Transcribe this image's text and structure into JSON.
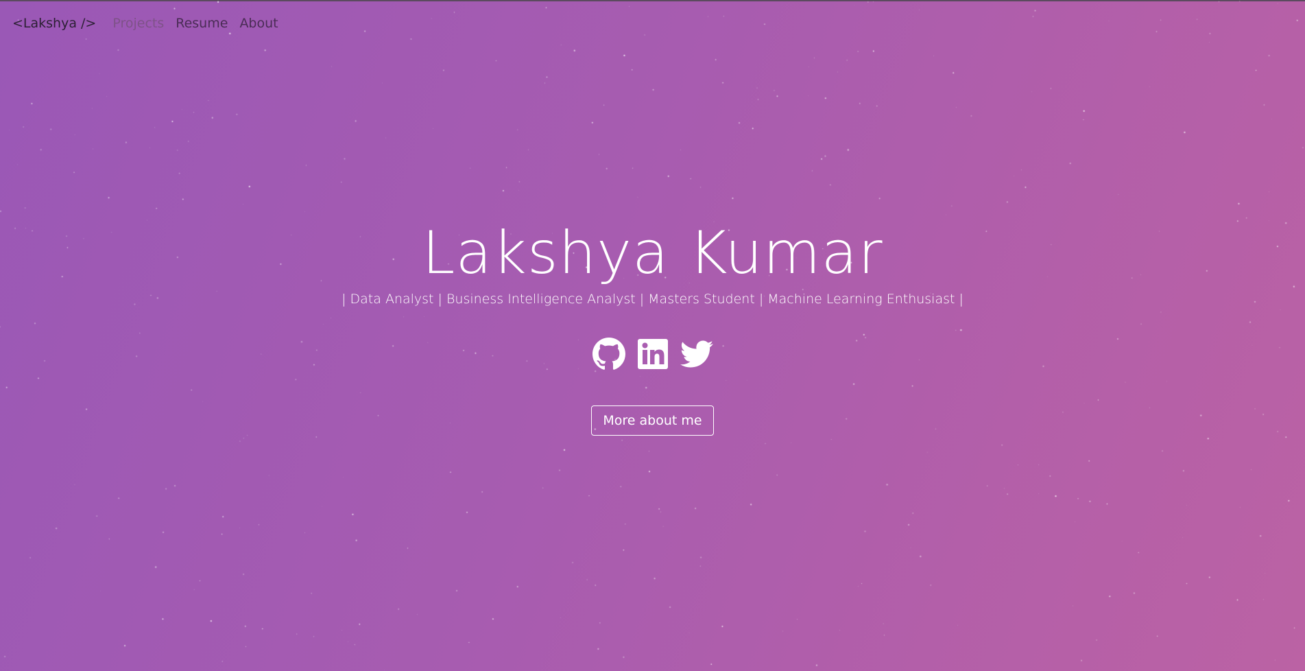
{
  "nav": {
    "brand": "<Lakshya />",
    "links": [
      {
        "label": "Projects"
      },
      {
        "label": "Resume"
      },
      {
        "label": "About"
      }
    ]
  },
  "hero": {
    "title": "Lakshya Kumar",
    "subtitle": "| Data Analyst | Business Intelligence Analyst | Masters Student | Machine Learning Enthusiast |",
    "button_label": "More about me"
  },
  "social": [
    {
      "icon": "github-icon"
    },
    {
      "icon": "linkedin-icon"
    },
    {
      "icon": "twitter-icon"
    }
  ],
  "colors": {
    "gradient_start": "#9a58b6",
    "gradient_end": "#bb62a4",
    "text": "#ffffff",
    "brand_text": "#2b1f33",
    "nav_text": "#4a2c55",
    "nav_text_muted": "#7e5288"
  }
}
